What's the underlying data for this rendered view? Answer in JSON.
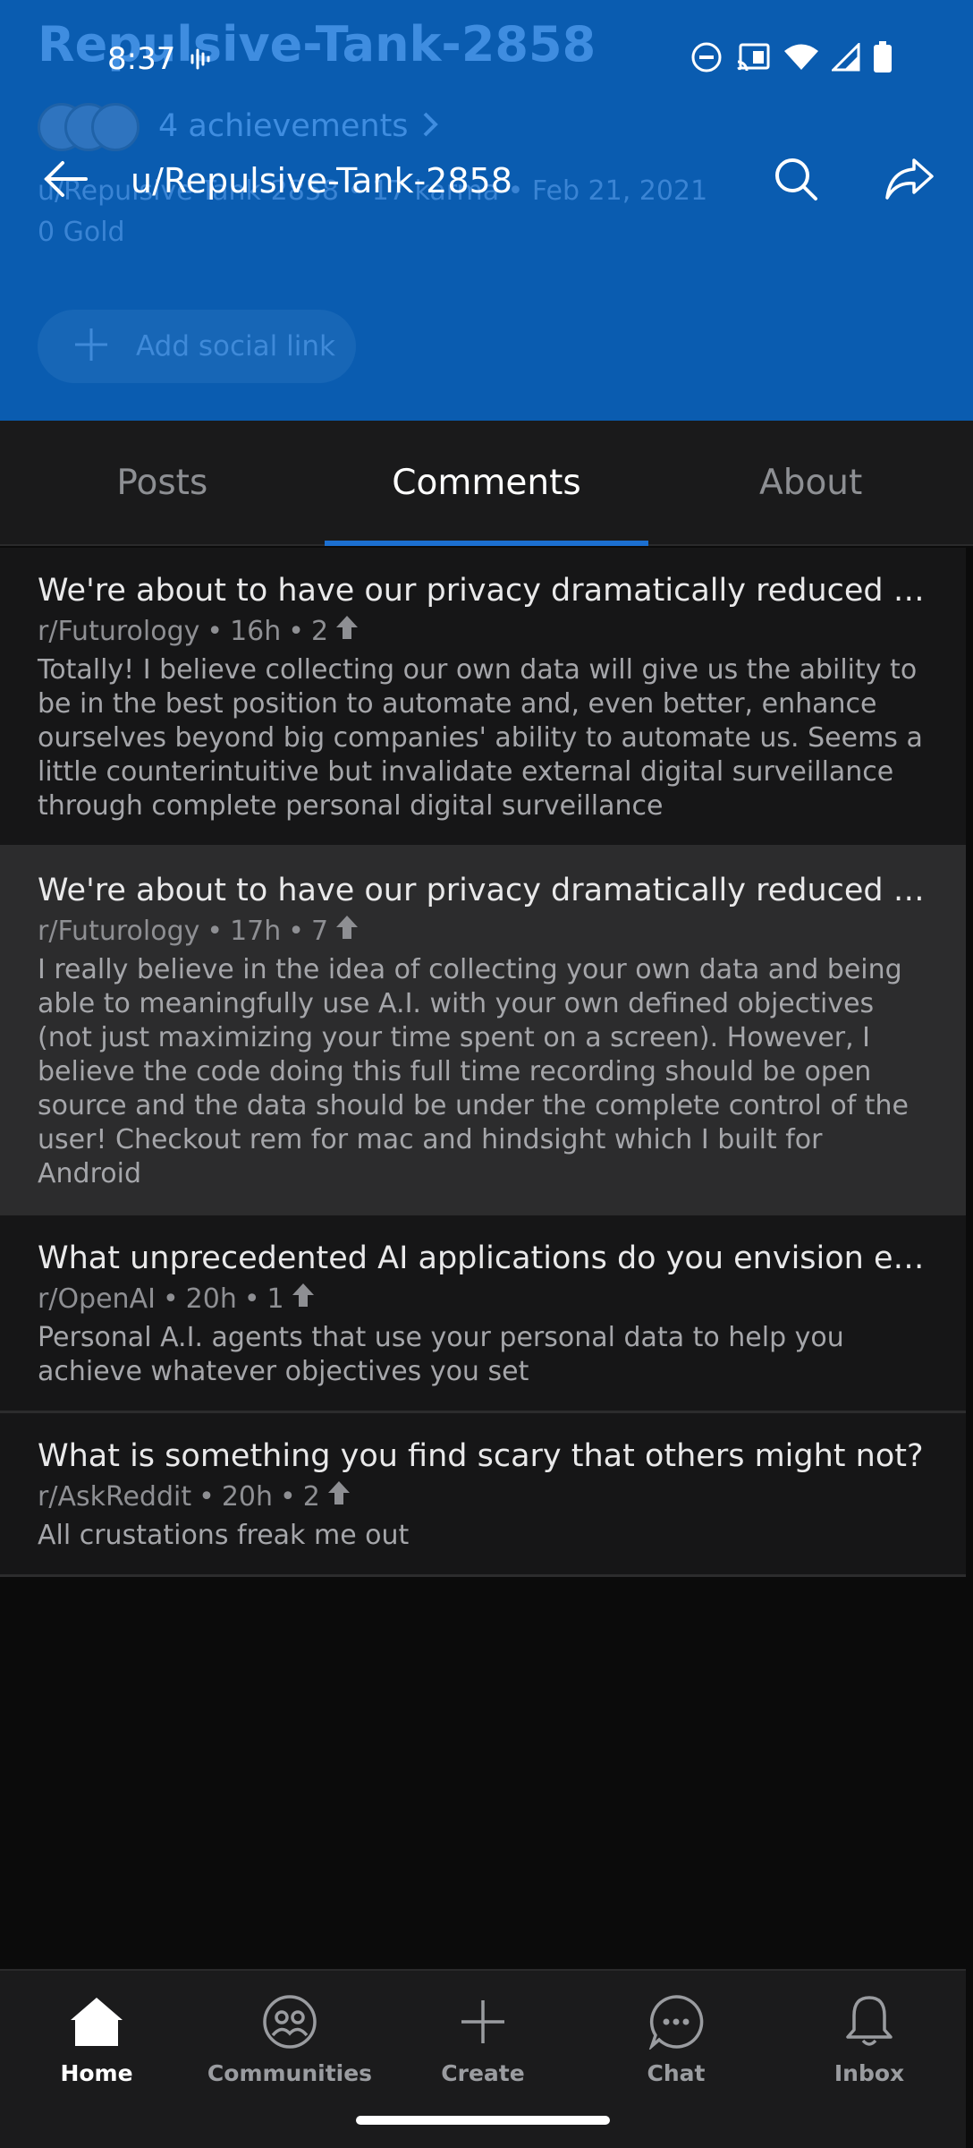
{
  "status_bar": {
    "time": "8:37"
  },
  "header": {
    "faded_username": "Repulsive-Tank-2858",
    "achievements": "4 achievements",
    "meta_line": "u/Repulsive-Tank-2858 • 17 karma • Feb 21, 2021",
    "gold": "0 Gold",
    "add_social_link": "Add social link",
    "title": "u/Repulsive-Tank-2858",
    "colors": {
      "header_bg": "#0a5cb0",
      "accent": "#1c6fd0"
    }
  },
  "tabs": [
    {
      "label": "Posts",
      "active": false
    },
    {
      "label": "Comments",
      "active": true
    },
    {
      "label": "About",
      "active": false
    }
  ],
  "comments": [
    {
      "title": "We're about to have our privacy dramatically reduced in de...",
      "subreddit": "r/Futurology",
      "age": "16h",
      "score": "2",
      "body": "Totally! I believe collecting our own data will give us the ability to be in the best position to automate and, even better, enhance ourselves beyond big companies' ability to automate us. Seems a little counterintuitive but invalidate external digital surveillance through complete personal digital surveillance"
    },
    {
      "title": "We're about to have our privacy dramatically reduced in de...",
      "subreddit": "r/Futurology",
      "age": "17h",
      "score": "7",
      "body": "I really believe in the idea of collecting your own data and being able to meaningfully use A.I. with your own defined objectives (not just maximizing your time spent on a screen). However, I believe the code doing this full time recording should be open source and the data should be under the complete control of the user!  Checkout rem for mac and hindsight which I built for Android"
    },
    {
      "title": "What unprecedented AI applications do you envision emer...",
      "subreddit": "r/OpenAI",
      "age": "20h",
      "score": "1",
      "body": "Personal A.I. agents that use your personal data to help you achieve whatever objectives you set"
    },
    {
      "title": "What is something you find scary that others might not?",
      "subreddit": "r/AskReddit",
      "age": "20h",
      "score": "2",
      "body": "All crustations freak me out"
    }
  ],
  "bottom_nav": [
    {
      "label": "Home",
      "icon": "home-icon",
      "active": true
    },
    {
      "label": "Communities",
      "icon": "communities-icon",
      "active": false
    },
    {
      "label": "Create",
      "icon": "plus-icon",
      "active": false
    },
    {
      "label": "Chat",
      "icon": "chat-icon",
      "active": false
    },
    {
      "label": "Inbox",
      "icon": "bell-icon",
      "active": false
    }
  ]
}
